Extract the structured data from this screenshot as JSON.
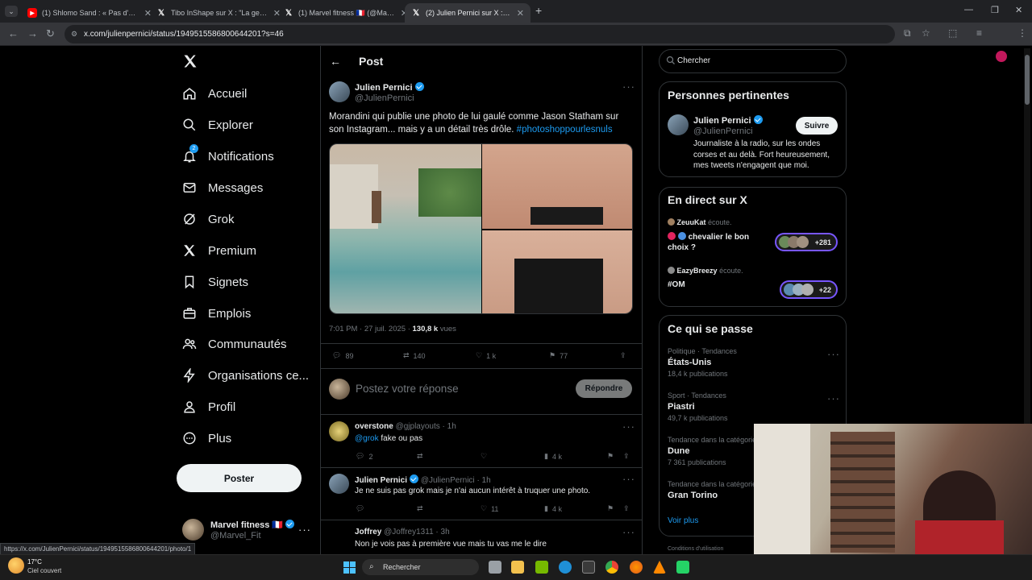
{
  "browser": {
    "tabs": [
      {
        "title": "(1) Shlomo Sand : « Pas d'aveni",
        "icon": "youtube-icon"
      },
      {
        "title": "Tibo InShape sur X : \"La gens q",
        "icon": "x-logo-icon"
      },
      {
        "title": "(1) Marvel fitness 🇫🇷 (@Marvel_",
        "icon": "x-logo-icon"
      },
      {
        "title": "(2) Julien Pernici sur X : \"Moran",
        "icon": "x-logo-icon"
      }
    ],
    "active_tab": 3,
    "url": "x.com/julienpernici/status/1949515586800644201?s=46",
    "status_url": "https://x.com/JulienPernici/status/1949515586800644201/photo/1"
  },
  "sidebar": {
    "items": [
      {
        "label": "Accueil",
        "icon": "home-icon"
      },
      {
        "label": "Explorer",
        "icon": "search-icon"
      },
      {
        "label": "Notifications",
        "icon": "bell-icon",
        "badge": "2"
      },
      {
        "label": "Messages",
        "icon": "mail-icon"
      },
      {
        "label": "Grok",
        "icon": "grok-icon"
      },
      {
        "label": "Premium",
        "icon": "x-logo-icon"
      },
      {
        "label": "Signets",
        "icon": "bookmark-icon"
      },
      {
        "label": "Emplois",
        "icon": "briefcase-icon"
      },
      {
        "label": "Communautés",
        "icon": "people-icon"
      },
      {
        "label": "Organisations ce...",
        "icon": "lightning-icon"
      },
      {
        "label": "Profil",
        "icon": "user-icon"
      },
      {
        "label": "Plus",
        "icon": "more-circle-icon"
      }
    ],
    "post_button": "Poster",
    "account": {
      "name": "Marvel fitness 🇫🇷",
      "handle": "@Marvel_Fit"
    }
  },
  "post": {
    "header": "Post",
    "author": {
      "name": "Julien Pernici",
      "handle": "@JulienPernici"
    },
    "text": "Morandini qui publie une photo de lui gaulé comme Jason Statham sur son Instagram... mais y a un détail très drôle. ",
    "hashtag": "#photoshoppourlesnuls",
    "time": "7:01 PM · 27 juil. 2025 · ",
    "views": "130,8 k",
    "views_label": " vues",
    "stats": {
      "replies": "89",
      "reposts": "140",
      "likes": "1 k",
      "bookmarks": "77"
    },
    "reply_placeholder": "Postez votre réponse",
    "reply_button": "Répondre"
  },
  "replies": [
    {
      "name": "overstone",
      "handle": "@gjplayouts",
      "time": "· 1h",
      "mention": "@grok",
      "text": " fake ou pas",
      "replies": "2",
      "reposts": "",
      "likes": "",
      "views": "4 k"
    },
    {
      "name": "Julien Pernici",
      "handle": "@JulienPernici",
      "time": "· 1h",
      "mention": "",
      "text": "Je ne suis pas grok mais je n'ai aucun intérêt à truquer une photo.",
      "replies": "",
      "reposts": "",
      "likes": "11",
      "views": "4 k"
    },
    {
      "name": "Joffrey",
      "handle": "@Joffrey1311",
      "time": "· 3h",
      "mention": "",
      "text": "Non je vois pas à première vue mais tu vas me le dire"
    }
  ],
  "right": {
    "search_placeholder": "Chercher",
    "relevant": {
      "title": "Personnes pertinentes",
      "name": "Julien Pernici",
      "handle": "@JulienPernici",
      "follow": "Suivre",
      "bio": "Journaliste à la radio, sur les ondes corses et au delà. Fort heureusement, mes tweets n'engagent que moi."
    },
    "live": {
      "title": "En direct sur X",
      "items": [
        {
          "host": "ZeuuKat",
          "listening": "écoute.",
          "title": "chevalier le bon choix ?",
          "count": "+281"
        },
        {
          "host": "EazyBreezy",
          "listening": "écoute.",
          "title": "#OM",
          "count": "+22"
        }
      ]
    },
    "trends": {
      "title": "Ce qui se passe",
      "items": [
        {
          "category": "Politique · Tendances",
          "name": "États-Unis",
          "count": "18,4 k publications"
        },
        {
          "category": "Sport · Tendances",
          "name": "Piastri",
          "count": "49,7 k publications"
        },
        {
          "category": "Tendance dans la catégorie",
          "name": "Dune",
          "count": "7 361 publications"
        },
        {
          "category": "Tendance dans la catégorie",
          "name": "Gran Torino",
          "count": ""
        }
      ],
      "see_more": "Voir plus"
    },
    "footer": "Conditions d'utilisation"
  },
  "taskbar": {
    "weather_temp": "17°C",
    "weather_desc": "Ciel couvert",
    "search": "Rechercher"
  },
  "colors": {
    "accent": "#1d9bf0",
    "background": "#000000",
    "border": "#2f3336",
    "muted": "#71767b"
  }
}
